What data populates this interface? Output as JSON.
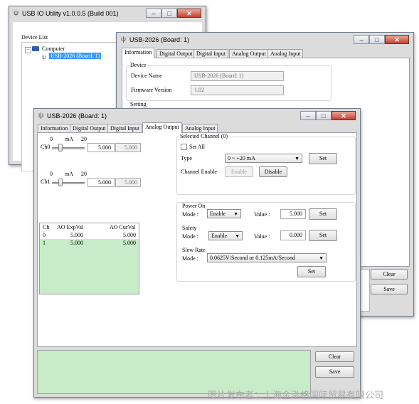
{
  "main_window": {
    "title": "USB IO Utility    v1.0.0.5 (Build 001)",
    "device_list_label": "Device List",
    "tree": {
      "root": "Computer",
      "child": "USB-2026 (Board: 1)"
    }
  },
  "info_window": {
    "title": "USB-2026 (Board: 1)",
    "tabs": [
      "Information",
      "Digital Output",
      "Digital Input",
      "Analog Output",
      "Analog Input"
    ],
    "device_group": "Device",
    "device_name_label": "Device Name",
    "device_name_value": "USB-2026 (Board: 1)",
    "firmware_label": "Firmware Version",
    "firmware_value": "1.02",
    "setting_group": "Setting",
    "clear_label": "Clear",
    "save_label": "Save"
  },
  "ao_window": {
    "title": "USB-2026 (Board: 1)",
    "tabs": [
      "Information",
      "Digital Output",
      "Digital Input",
      "Analog Output",
      "Analog Input"
    ],
    "channels": [
      {
        "name": "Ch0",
        "scale_min": "0",
        "scale_unit": "mA",
        "scale_max": "20",
        "set_value": "5.000",
        "read_value": "5.000",
        "level": 0.25
      },
      {
        "name": "Ch1",
        "scale_min": "0",
        "scale_unit": "mA",
        "scale_max": "20",
        "set_value": "5.000",
        "read_value": "5.000",
        "level": 0.25
      }
    ],
    "table": {
      "headers": [
        "Ch",
        "AO ExpVal",
        "AO CurVal"
      ],
      "rows": [
        [
          "0",
          "5.000",
          "5.000"
        ],
        [
          "1",
          "5.000",
          "5.000"
        ]
      ]
    },
    "selected_channel": {
      "group": "Selected Channel (0)",
      "set_all": "Set All",
      "type_label": "Type",
      "type_value": "0 ~ +20 mA",
      "set_label": "Set",
      "channel_enable_label": "Channel Enable",
      "enable_label": "Enable",
      "disable_label": "Disable"
    },
    "power_on": {
      "group": "Power On",
      "mode_label": "Mode :",
      "mode_value": "Enable",
      "value_label": "Value :",
      "value": "5.000",
      "set_label": "Set"
    },
    "safety": {
      "group": "Safety",
      "mode_label": "Mode :",
      "mode_value": "Enable",
      "value_label": "Value :",
      "value": "0.000",
      "set_label": "Set"
    },
    "slew_rate": {
      "group": "Slew Rate",
      "mode_label": "Mode :",
      "mode_value": "0.0625V/Second or 0.125mA/Second",
      "set_label": "Set"
    },
    "clear_label": "Clear",
    "save_label": "Save"
  },
  "watermark": "图片发布者：上海金泓格国际贸易有限公司",
  "colors": {
    "log_bg": "#c8ecc8",
    "selection": "#3399ff",
    "table_row_bg": "#c8ecc8"
  }
}
